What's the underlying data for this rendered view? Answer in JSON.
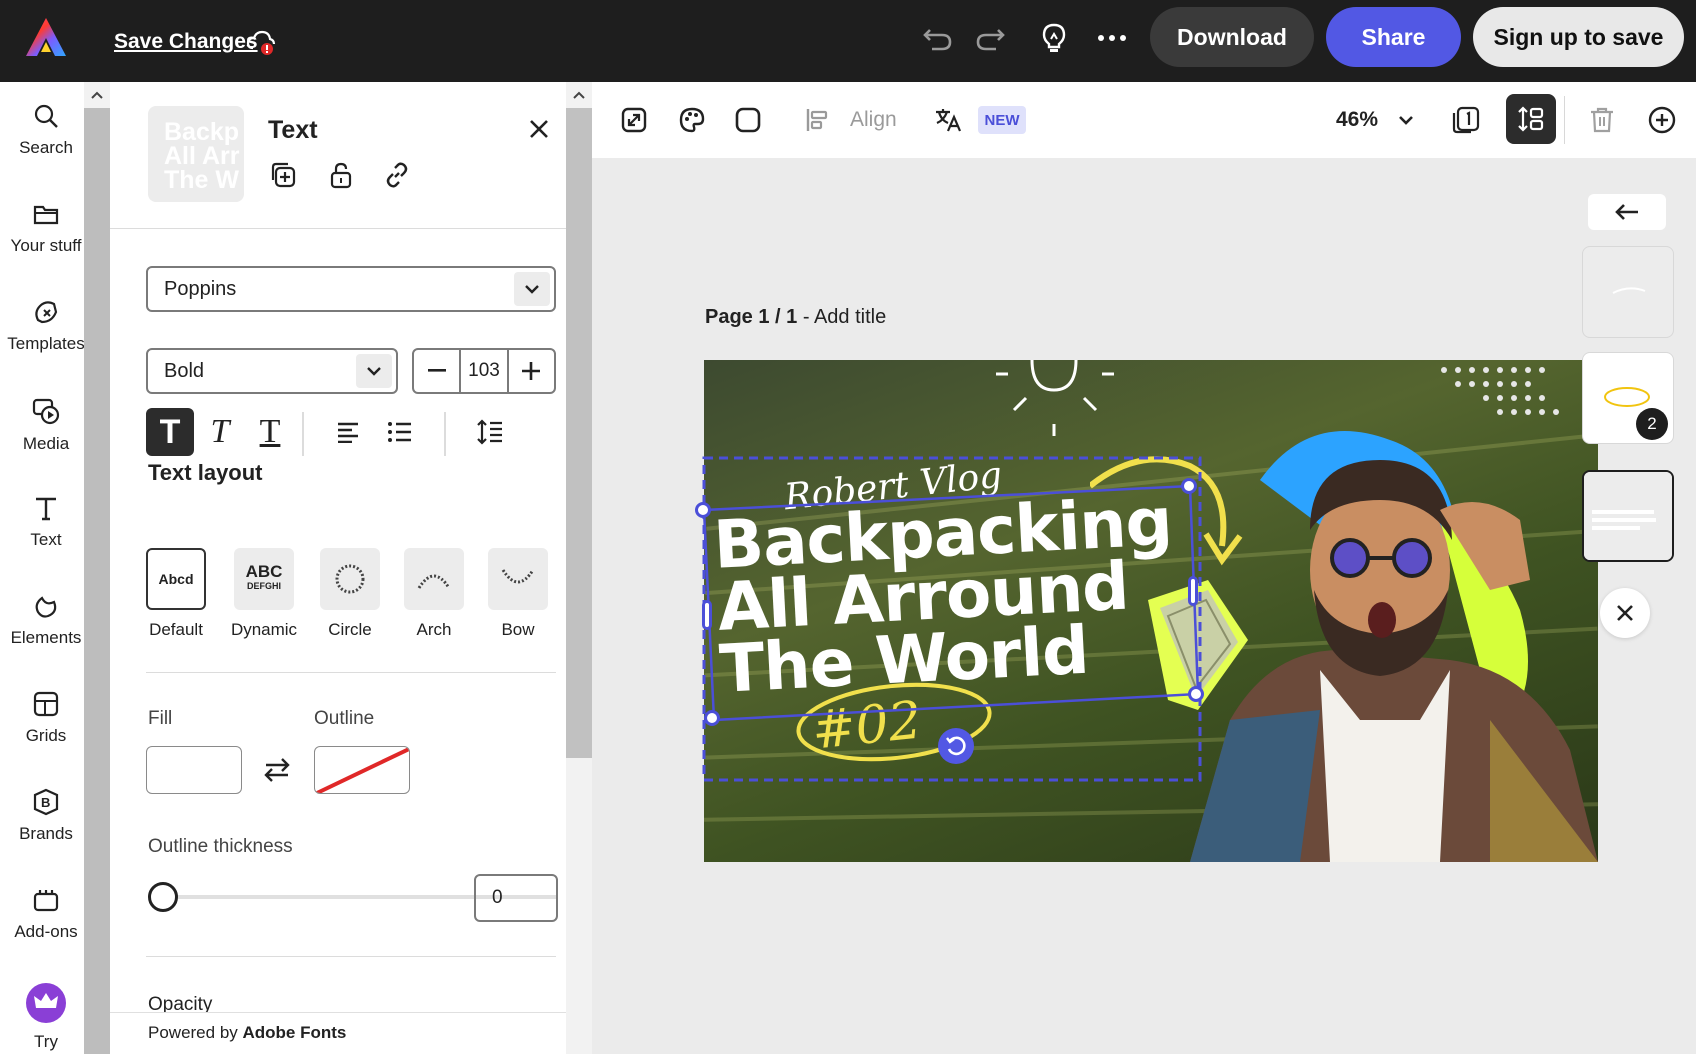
{
  "topbar": {
    "save_label": "Save Changes",
    "buttons": {
      "download": "Download",
      "share": "Share",
      "signup": "Sign up to save"
    },
    "icons": [
      "adobe-express-logo",
      "cloud-alert-icon",
      "undo-icon",
      "redo-icon",
      "lightbulb-icon",
      "more-icon"
    ]
  },
  "rail": {
    "items": [
      {
        "label": "Search",
        "icon": "search-icon"
      },
      {
        "label": "Your stuff",
        "icon": "folder-icon"
      },
      {
        "label": "Templates",
        "icon": "templates-icon"
      },
      {
        "label": "Media",
        "icon": "media-icon"
      },
      {
        "label": "Text",
        "icon": "text-icon"
      },
      {
        "label": "Elements",
        "icon": "elements-icon"
      },
      {
        "label": "Grids",
        "icon": "grids-icon"
      },
      {
        "label": "Brands",
        "icon": "brands-icon"
      },
      {
        "label": "Add-ons",
        "icon": "addons-icon"
      },
      {
        "label": "Try",
        "icon": "premium-crown-icon"
      }
    ]
  },
  "panel": {
    "title": "Text",
    "thumb_text": "Backp\nAll Arr\nThe W",
    "font_family": "Poppins",
    "font_weight": "Bold",
    "font_size": "103",
    "text_layout_title": "Text layout",
    "layouts": [
      {
        "label": "Default",
        "preview": "Abcd"
      },
      {
        "label": "Dynamic",
        "preview": "ABC"
      },
      {
        "label": "Circle",
        "preview": ""
      },
      {
        "label": "Arch",
        "preview": ""
      },
      {
        "label": "Bow",
        "preview": ""
      }
    ],
    "fill_label": "Fill",
    "outline_label": "Outline",
    "outline_thickness_label": "Outline thickness",
    "outline_thickness_value": "0",
    "opacity_label": "Opacity",
    "footer_prefix": "Powered by ",
    "footer_brand": "Adobe Fonts"
  },
  "canvas_toolbar": {
    "align_label": "Align",
    "new_badge": "NEW",
    "zoom": "46%"
  },
  "canvas": {
    "page_label_bold": "Page 1 / 1",
    "page_label_rest": " - Add title",
    "artwork": {
      "vlog": "Robert Vlog",
      "line1": "Backpacking",
      "line2": "All Arround",
      "line3": "The World",
      "number": "#02"
    }
  },
  "pages": {
    "badge": "2"
  },
  "colors": {
    "topbar_bg": "#1e1e1e",
    "accent": "#5258e4",
    "selection": "#4b4fd8",
    "highlight_yellow": "#f1e04c"
  }
}
